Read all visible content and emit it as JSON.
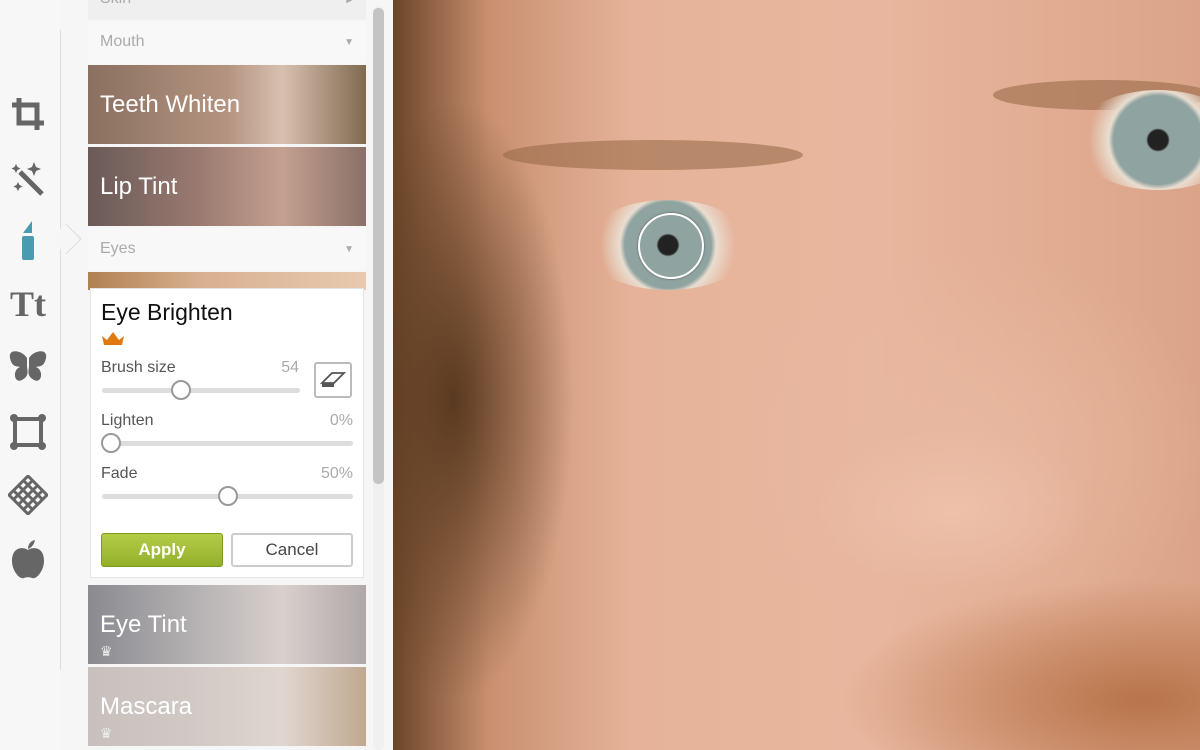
{
  "toolbar": {
    "tools": [
      {
        "icon": "crop-icon",
        "glyph": "⌗"
      },
      {
        "icon": "magic-wand-icon",
        "glyph": "✨"
      },
      {
        "icon": "lipstick-icon",
        "glyph": "▮",
        "active": true
      },
      {
        "icon": "text-icon",
        "glyph": "Tt"
      },
      {
        "icon": "butterfly-icon",
        "glyph": "🦋"
      },
      {
        "icon": "frame-icon",
        "glyph": "▢"
      },
      {
        "icon": "texture-icon",
        "glyph": "▩"
      },
      {
        "icon": "apple-icon",
        "glyph": "🍎"
      }
    ],
    "active_color": "#4a9bb0"
  },
  "panel": {
    "skin_header": "Skin",
    "mouth_header": "Mouth",
    "teeth_whiten": "Teeth Whiten",
    "lip_tint": "Lip Tint",
    "eyes_header": "Eyes",
    "eye_brighten": {
      "title": "Eye Brighten",
      "premium_icon": "crown-icon",
      "premium_color": "#e07a10",
      "brush_size": {
        "label": "Brush size",
        "value": "54",
        "fraction": 0.4
      },
      "lighten": {
        "label": "Lighten",
        "value": "0%",
        "fraction": 0
      },
      "fade": {
        "label": "Fade",
        "value": "50%",
        "fraction": 0.5
      },
      "eraser_icon": "eraser-icon",
      "apply": "Apply",
      "cancel": "Cancel",
      "apply_color": "#9dba2e"
    },
    "eye_tint": "Eye Tint",
    "mascara": "Mascara"
  }
}
